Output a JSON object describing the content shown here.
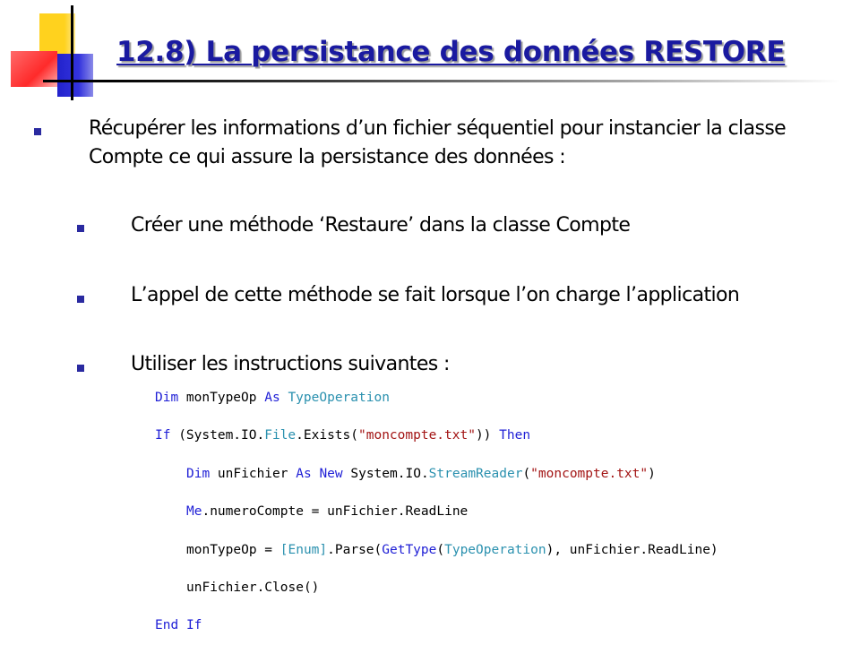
{
  "title": "12.8) La persistance des données RESTORE",
  "bullets": {
    "main": "Récupérer les informations d’un fichier séquentiel pour instancier la classe Compte ce qui assure la persistance des données :",
    "sub": [
      "Créer une méthode ‘Restaure’ dans la classe Compte",
      "L’appel de cette méthode se fait lorsque l’on charge l’application",
      "Utiliser les instructions suivantes :"
    ]
  },
  "code": {
    "line1": {
      "kw1": "Dim",
      "t1": " monTypeOp ",
      "kw2": "As",
      "t2": " ",
      "ty1": "TypeOperation"
    },
    "line2": {
      "kw1": "If",
      "t1": " (System.IO.",
      "ty1": "File",
      "t2": ".Exists(",
      "st1": "\"moncompte.txt\"",
      "t3": ")) ",
      "kw2": "Then"
    },
    "line3": {
      "kw1": "Dim",
      "t1": " unFichier ",
      "kw2": "As",
      "t2": " ",
      "kw3": "New",
      "t3": " System.IO.",
      "ty1": "StreamReader",
      "t4": "(",
      "st1": "\"moncompte.txt\"",
      "t5": ")"
    },
    "line4": {
      "kw1": "Me",
      "t1": ".numeroCompte = unFichier.ReadLine"
    },
    "line5": {
      "t1": "monTypeOp = ",
      "ty1": "[Enum]",
      "t2": ".Parse(",
      "kw1": "GetType",
      "t3": "(",
      "ty2": "TypeOperation",
      "t4": "), unFichier.ReadLine)"
    },
    "line6": {
      "t1": "unFichier.Close()"
    },
    "line7": {
      "kw1": "End",
      "t1": " ",
      "kw2": "If"
    }
  }
}
